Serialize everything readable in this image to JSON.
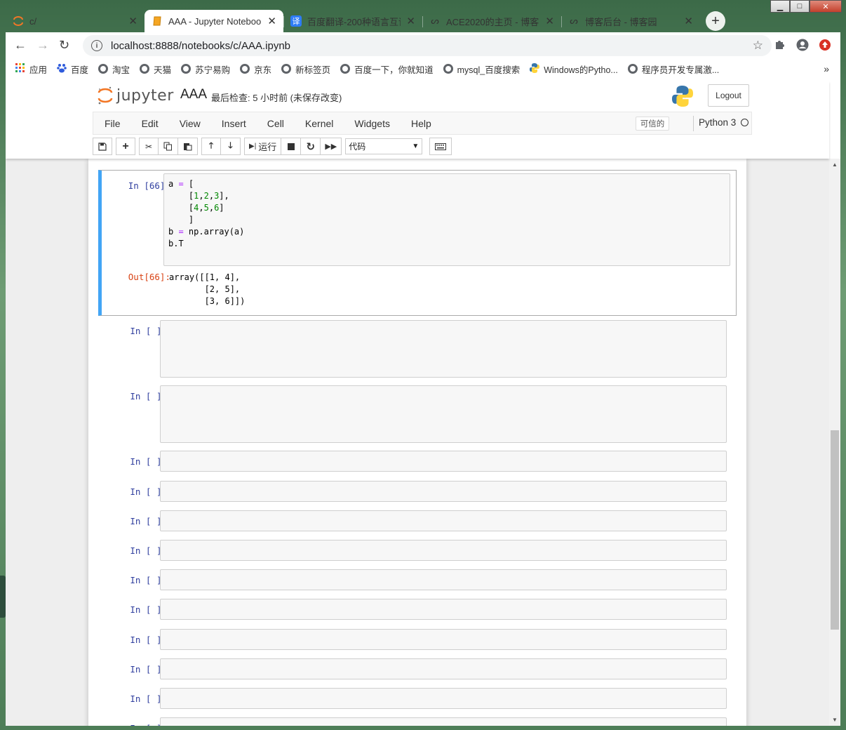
{
  "window": {
    "minimize": "▁",
    "maximize": "□",
    "close": "✕"
  },
  "tabs": [
    {
      "title": "c/",
      "icon": "jupyter-icon",
      "active": false
    },
    {
      "title": "AAA - Jupyter Noteboo",
      "icon": "notebook-icon",
      "active": true
    },
    {
      "title": "百度翻译-200种语言互译",
      "icon": "translate-icon",
      "active": false
    },
    {
      "title": "ACE2020的主页 - 博客园",
      "icon": "cnblogs-icon",
      "active": false
    },
    {
      "title": "博客后台 - 博客园",
      "icon": "cnblogs-icon",
      "active": false
    }
  ],
  "new_tab": "+",
  "address": {
    "url": "localhost:8888/notebooks/c/AAA.ipynb"
  },
  "bookmarks": [
    {
      "label": "应用",
      "icon": "apps-icon"
    },
    {
      "label": "百度",
      "icon": "baidu-icon"
    },
    {
      "label": "淘宝",
      "icon": "globe-icon"
    },
    {
      "label": "天猫",
      "icon": "globe-icon"
    },
    {
      "label": "苏宁易购",
      "icon": "globe-icon"
    },
    {
      "label": "京东",
      "icon": "globe-icon"
    },
    {
      "label": "新标签页",
      "icon": "globe-icon"
    },
    {
      "label": "百度一下，你就知道",
      "icon": "globe-icon"
    },
    {
      "label": "mysql_百度搜索",
      "icon": "globe-icon"
    },
    {
      "label": "Windows的Pytho...",
      "icon": "python-icon"
    },
    {
      "label": "程序员开发专属激...",
      "icon": "globe-icon"
    }
  ],
  "bookmarks_more": "»",
  "jupyter": {
    "brand": "jupyter",
    "notebook_name": "AAA",
    "checkpoint": "最后检查: 5 小时前  (未保存改变)",
    "logout": "Logout",
    "menus": [
      "File",
      "Edit",
      "View",
      "Insert",
      "Cell",
      "Kernel",
      "Widgets",
      "Help"
    ],
    "trusted": "可信的",
    "kernel": "Python 3",
    "run_label": "运行",
    "cell_type": "代码"
  },
  "cells": {
    "first": {
      "in_prompt": "In  [66]:",
      "out_prompt": "Out[66]:",
      "code_lines": [
        "a = [",
        "    [1,2,3],",
        "    [4,5,6]",
        "    ]",
        "b = np.array(a)",
        "b.T"
      ],
      "output": "array([[1, 4],\n       [2, 5],\n       [3, 6]])"
    },
    "empty_prompt": "In  [  ]:"
  }
}
